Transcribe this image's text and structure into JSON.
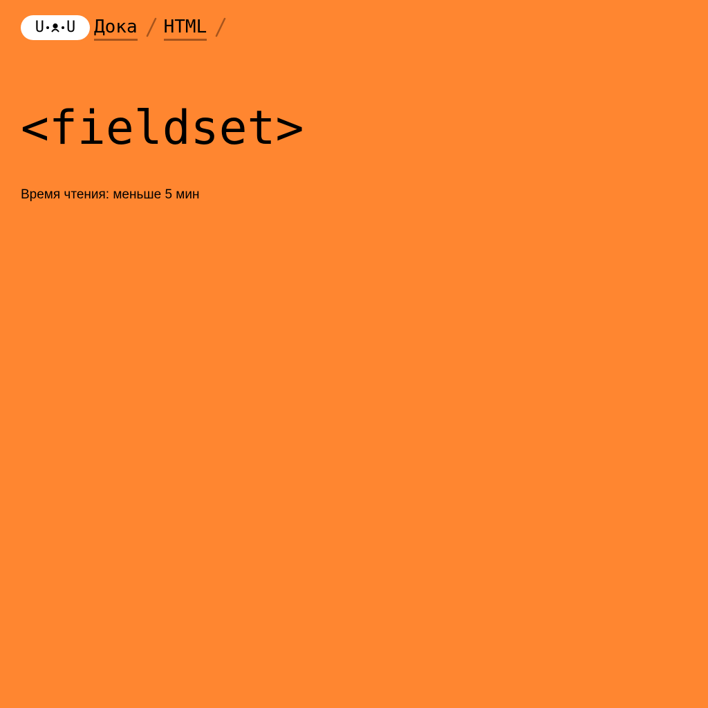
{
  "logo": {
    "left_glyph": "U",
    "right_glyph": "U",
    "icon": "doka-face-logo-icon"
  },
  "breadcrumb": {
    "items": [
      {
        "label": "Дока"
      },
      {
        "label": "HTML"
      }
    ],
    "separator_icon": "slash-separator-icon"
  },
  "page": {
    "title": "<fieldset>",
    "reading_time": "Время чтения: меньше 5 мин"
  },
  "colors": {
    "background": "#ff8630",
    "logo_background": "#ffffff",
    "link_underline": "#a6541c",
    "text": "#000000"
  }
}
